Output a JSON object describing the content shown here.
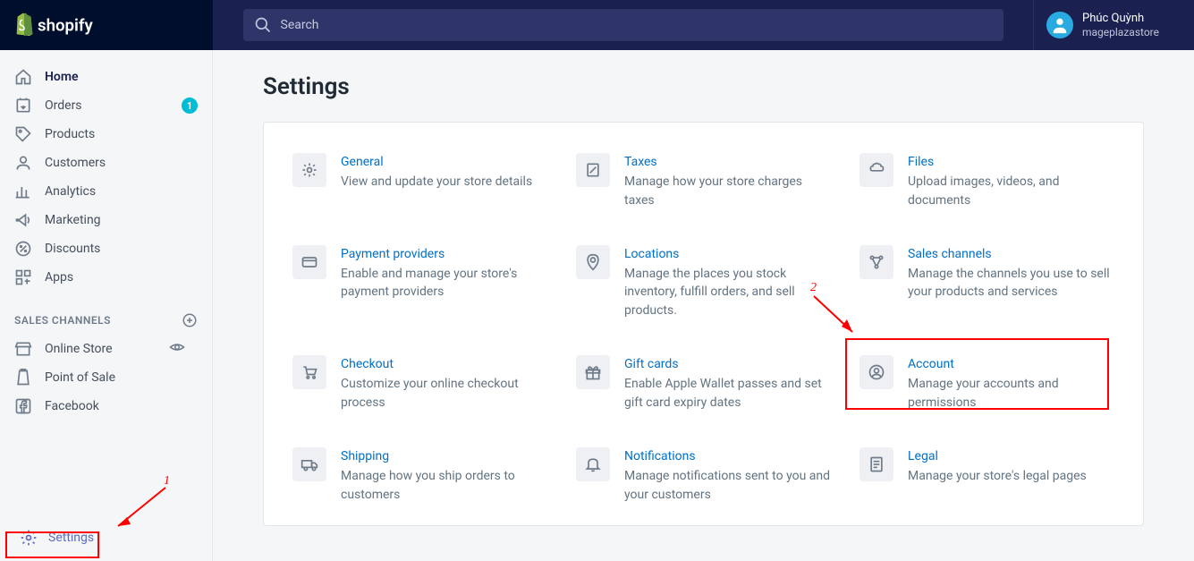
{
  "brand": "shopify",
  "search": {
    "placeholder": "Search"
  },
  "user": {
    "name": "Phúc Quỳnh",
    "store": "mageplazastore"
  },
  "nav": {
    "items": [
      {
        "label": "Home"
      },
      {
        "label": "Orders",
        "badge": "1"
      },
      {
        "label": "Products"
      },
      {
        "label": "Customers"
      },
      {
        "label": "Analytics"
      },
      {
        "label": "Marketing"
      },
      {
        "label": "Discounts"
      },
      {
        "label": "Apps"
      }
    ],
    "section": "SALES CHANNELS",
    "channels": [
      {
        "label": "Online Store"
      },
      {
        "label": "Point of Sale"
      },
      {
        "label": "Facebook"
      }
    ],
    "settings": "Settings"
  },
  "page": {
    "title": "Settings"
  },
  "tiles": [
    {
      "title": "General",
      "desc": "View and update your store details"
    },
    {
      "title": "Taxes",
      "desc": "Manage how your store charges taxes"
    },
    {
      "title": "Files",
      "desc": "Upload images, videos, and documents"
    },
    {
      "title": "Payment providers",
      "desc": "Enable and manage your store's payment providers"
    },
    {
      "title": "Locations",
      "desc": "Manage the places you stock inventory, fulfill orders, and sell products."
    },
    {
      "title": "Sales channels",
      "desc": "Manage the channels you use to sell your products and services"
    },
    {
      "title": "Checkout",
      "desc": "Customize your online checkout process"
    },
    {
      "title": "Gift cards",
      "desc": "Enable Apple Wallet passes and set gift card expiry dates"
    },
    {
      "title": "Account",
      "desc": "Manage your accounts and permissions"
    },
    {
      "title": "Shipping",
      "desc": "Manage how you ship orders to customers"
    },
    {
      "title": "Notifications",
      "desc": "Manage notifications sent to you and your customers"
    },
    {
      "title": "Legal",
      "desc": "Manage your store's legal pages"
    }
  ],
  "annotations": {
    "one": "1",
    "two": "2"
  }
}
